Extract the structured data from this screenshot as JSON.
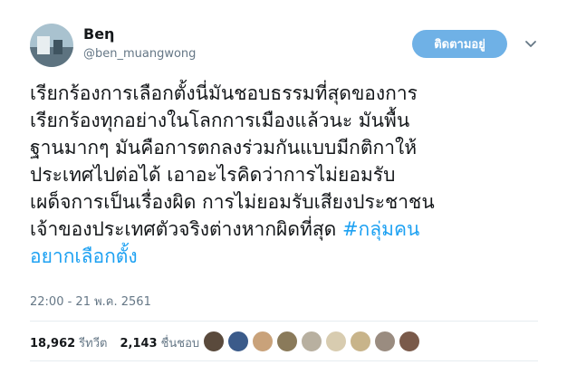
{
  "author": {
    "display_name": "Beη",
    "handle": "@ben_muangwong"
  },
  "follow_button_label": "ติดตามอยู่",
  "tweet": {
    "lines": [
      {
        "text": "เรียกร้องการเลือกตั้งนี่มันชอบธรรมที่สุดของการ",
        "hashtag": ""
      },
      {
        "text": "เรียกร้องทุกอย่างในโลกการเมืองแล้วนะ มันพื้น",
        "hashtag": ""
      },
      {
        "text": "ฐานมากๆ มันคือการตกลงร่วมกันแบบมีกติกาให้",
        "hashtag": ""
      },
      {
        "text": "ประเทศไปต่อได้ เอาอะไรคิดว่าการไม่ยอมรับ",
        "hashtag": ""
      },
      {
        "text": "เผด็จการเป็นเรื่องผิด การไม่ยอมรับเสียงประชาชน",
        "hashtag": ""
      },
      {
        "text": "เจ้าของประเทศตัวจริงต่างหากผิดที่สุด ",
        "hashtag": "#กลุ่มคน"
      },
      {
        "text": "",
        "hashtag": "อยากเลือกตั้ง"
      }
    ]
  },
  "timestamp": "22:00 - 21 พ.ค. 2561",
  "stats": {
    "retweets_count": "18,962",
    "retweets_label": "รีทวีต",
    "likes_count": "2,143",
    "likes_label": "ชื่นชอบ"
  },
  "liker_colors": [
    "#5a4a3c",
    "#3b5b8a",
    "#c9a27a",
    "#8a7a5a",
    "#b8b0a0",
    "#d8ccb0",
    "#c8b48a",
    "#9a8c80",
    "#7a5a4a"
  ],
  "colors": {
    "hashtag": "#1da1f2",
    "follow_button": "#6fb1e6"
  }
}
